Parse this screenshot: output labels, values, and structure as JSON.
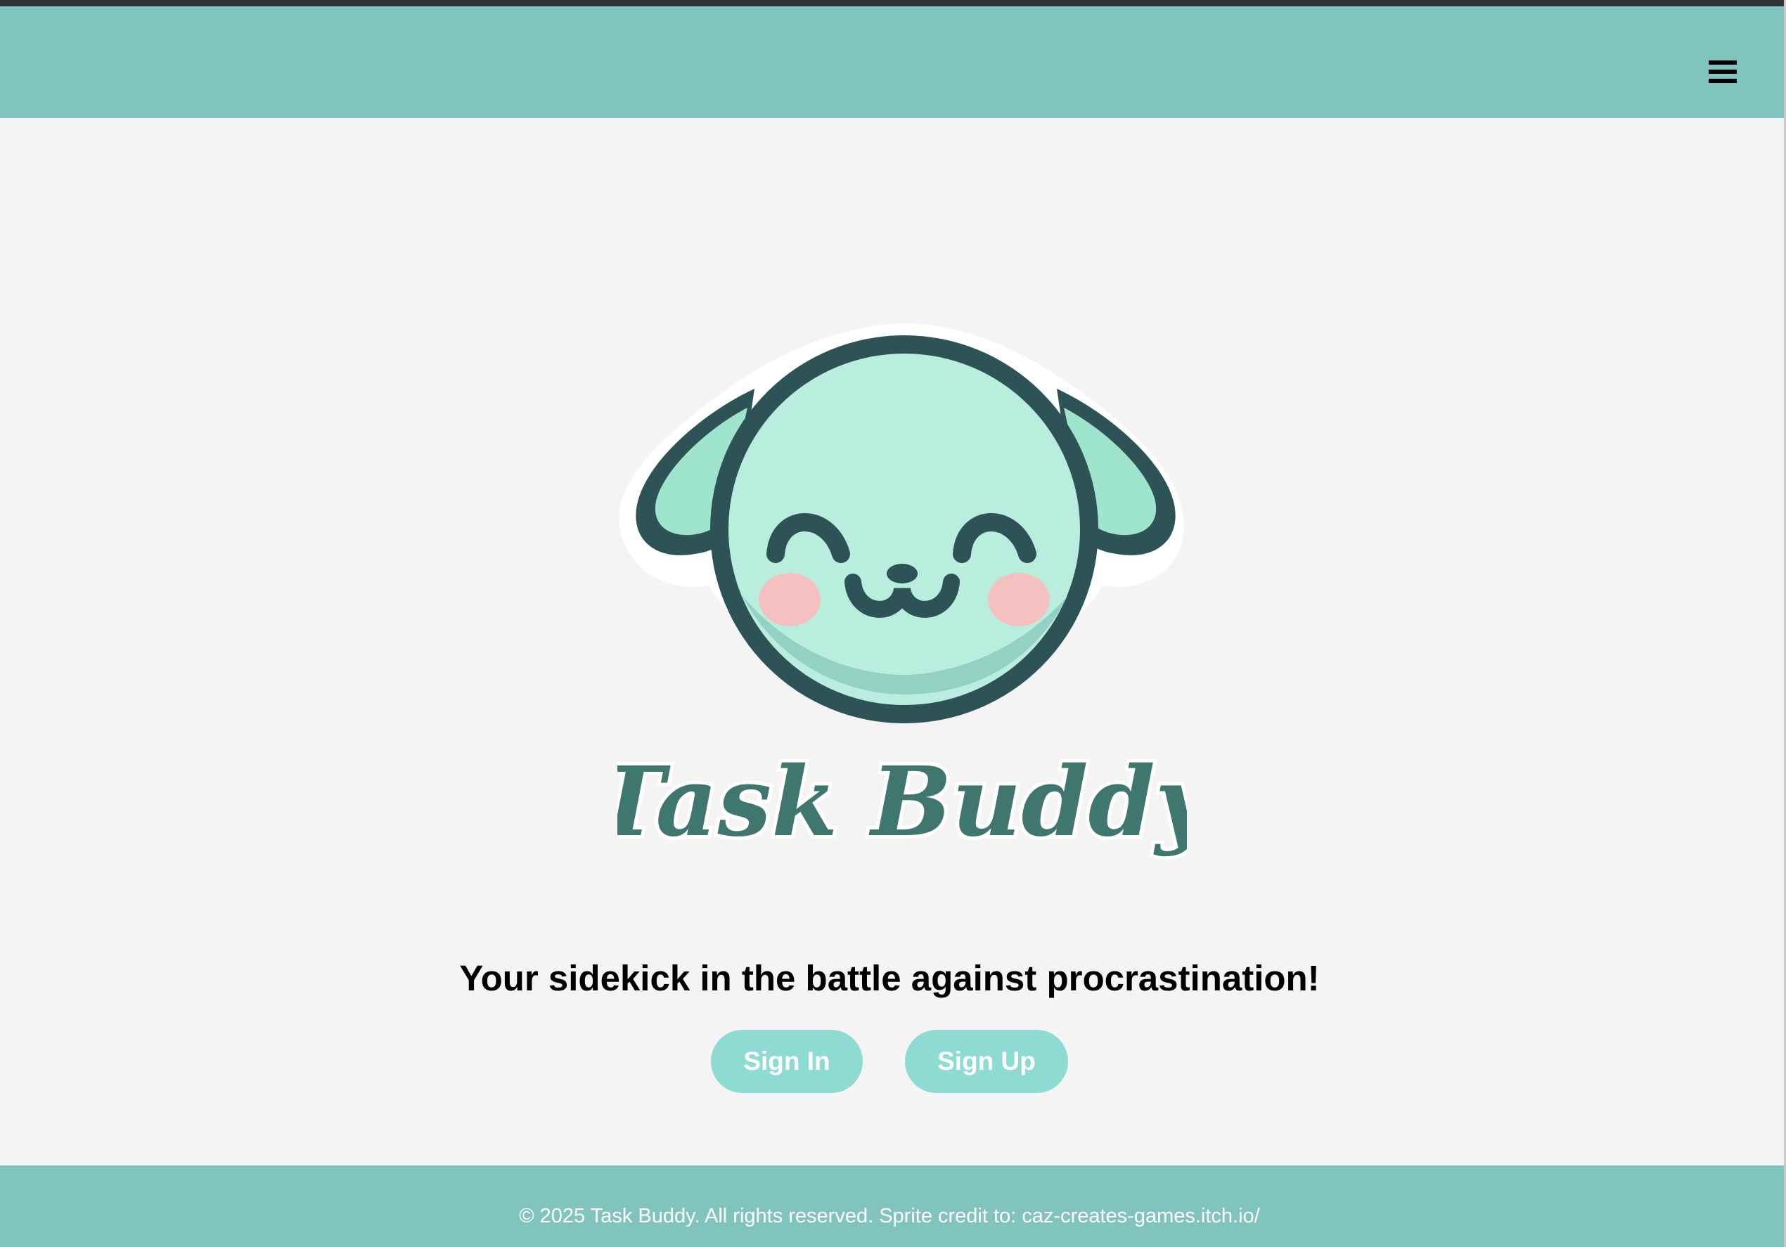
{
  "header": {
    "menu_icon": "hamburger-menu-icon"
  },
  "logo": {
    "wordmark": "Task Buddy",
    "mascot": "smiling-dog-face-icon"
  },
  "hero": {
    "tagline": "Your sidekick in the battle against procrastination!",
    "sign_in_label": "Sign In",
    "sign_up_label": "Sign Up"
  },
  "footer": {
    "text": "© 2025 Task Buddy. All rights reserved. Sprite credit to: caz-creates-games.itch.io/"
  },
  "colors": {
    "header_bg": "#80c4bd",
    "page_bg": "#f4f4f4",
    "button_bg": "#8edbd3",
    "button_text": "#ffffff",
    "mascot_face": "#b8ede0",
    "mascot_outline": "#2e5357",
    "cheek": "#f5c1c0",
    "wordmark": "#3f776f"
  }
}
